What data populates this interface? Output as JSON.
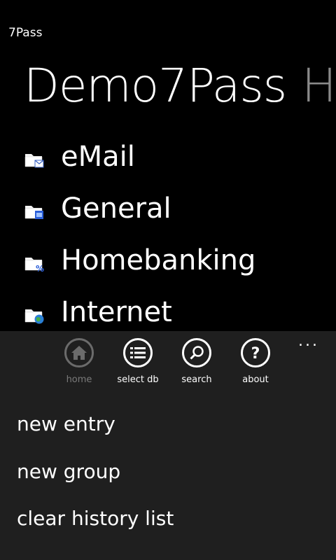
{
  "app": {
    "title": "7Pass"
  },
  "pivot": {
    "current": "Demo7Pass",
    "next": "H"
  },
  "groups": [
    {
      "label": "eMail",
      "icon": "folder-email-icon"
    },
    {
      "label": "General",
      "icon": "folder-general-icon"
    },
    {
      "label": "Homebanking",
      "icon": "folder-percent-icon"
    },
    {
      "label": "Internet",
      "icon": "folder-globe-icon"
    }
  ],
  "app_bar": {
    "more": "...",
    "buttons": [
      {
        "label": "home",
        "icon": "home-icon",
        "enabled": false
      },
      {
        "label": "select db",
        "icon": "list-icon",
        "enabled": true
      },
      {
        "label": "search",
        "icon": "search-icon",
        "enabled": true
      },
      {
        "label": "about",
        "icon": "question-icon",
        "enabled": true
      }
    ],
    "menu_items": [
      "new entry",
      "new group",
      "clear history list"
    ]
  },
  "colors": {
    "background": "#000000",
    "app_bar": "#1f1f1f",
    "disabled": "#7a7a7a"
  }
}
